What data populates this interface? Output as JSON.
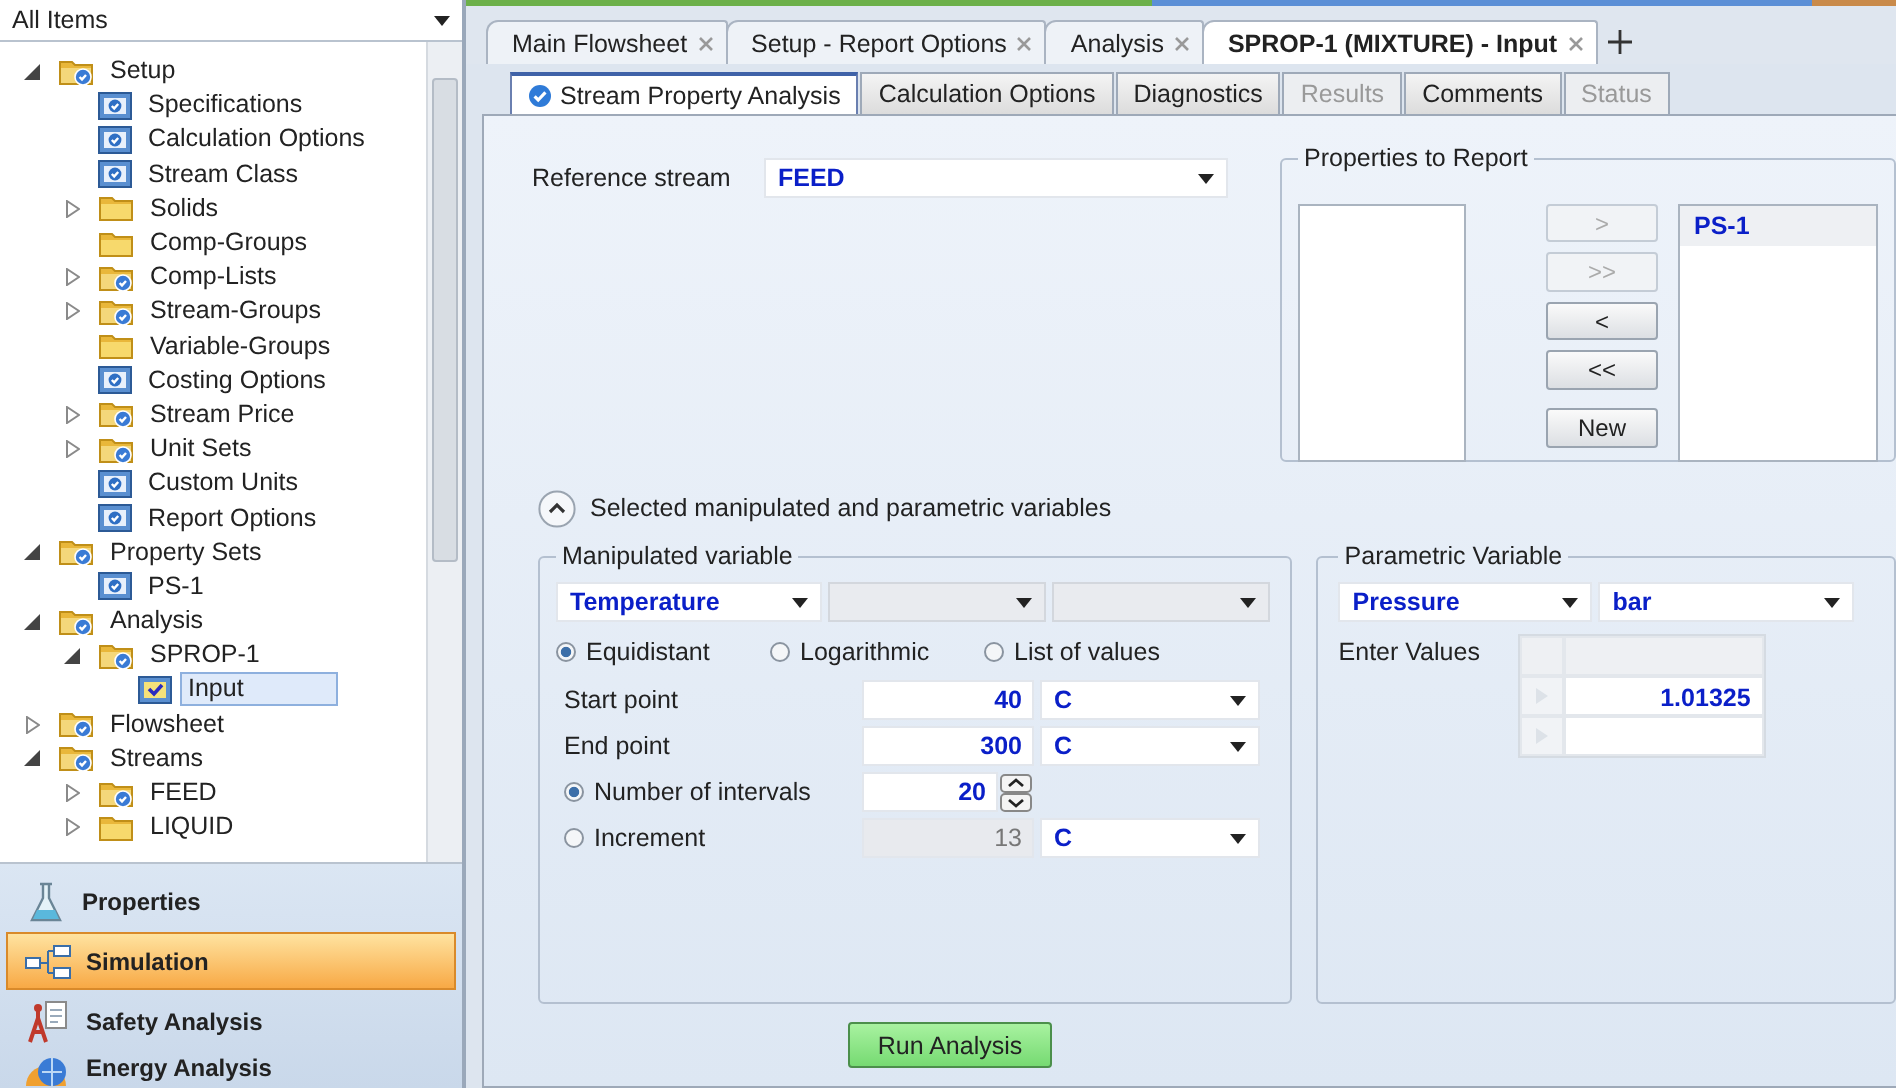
{
  "sidebar": {
    "filter": "All Items",
    "tree": [
      {
        "label": "Setup",
        "kind": "folder-check",
        "expanded": true,
        "selected": false,
        "children": [
          {
            "label": "Specifications",
            "kind": "form",
            "selected": false
          },
          {
            "label": "Calculation Options",
            "kind": "form",
            "selected": false
          },
          {
            "label": "Stream Class",
            "kind": "form",
            "selected": false
          },
          {
            "label": "Solids",
            "kind": "folder",
            "expanded": false,
            "selected": false
          },
          {
            "label": "Comp-Groups",
            "kind": "folder",
            "selected": false
          },
          {
            "label": "Comp-Lists",
            "kind": "folder-check",
            "expanded": false,
            "selected": false
          },
          {
            "label": "Stream-Groups",
            "kind": "folder-check",
            "expanded": false,
            "selected": false
          },
          {
            "label": "Variable-Groups",
            "kind": "folder",
            "selected": false
          },
          {
            "label": "Costing Options",
            "kind": "form",
            "selected": false
          },
          {
            "label": "Stream Price",
            "kind": "folder-check",
            "expanded": false,
            "selected": false
          },
          {
            "label": "Unit Sets",
            "kind": "folder-check",
            "expanded": false,
            "selected": false
          },
          {
            "label": "Custom Units",
            "kind": "form",
            "selected": false
          },
          {
            "label": "Report Options",
            "kind": "form",
            "selected": false
          }
        ]
      },
      {
        "label": "Property Sets",
        "kind": "folder-check",
        "expanded": true,
        "selected": false,
        "children": [
          {
            "label": "PS-1",
            "kind": "form",
            "selected": false
          }
        ]
      },
      {
        "label": "Analysis",
        "kind": "folder-check",
        "expanded": true,
        "selected": false,
        "children": [
          {
            "label": "SPROP-1",
            "kind": "folder-check",
            "expanded": true,
            "selected": false,
            "children": [
              {
                "label": "Input",
                "kind": "input",
                "selected": true
              }
            ]
          }
        ]
      },
      {
        "label": "Flowsheet",
        "kind": "folder-check",
        "expanded": false,
        "selected": false
      },
      {
        "label": "Streams",
        "kind": "folder-check",
        "expanded": true,
        "selected": false,
        "children": [
          {
            "label": "FEED",
            "kind": "folder-check",
            "expanded": false,
            "selected": false
          },
          {
            "label": "LIQUID",
            "kind": "folder",
            "expanded": false,
            "selected": false
          }
        ]
      }
    ],
    "nav": [
      {
        "label": "Properties",
        "kind": "flask",
        "selected": false
      },
      {
        "label": "Simulation",
        "kind": "flowchart",
        "selected": true
      },
      {
        "label": "Safety Analysis",
        "kind": "safety",
        "selected": false
      },
      {
        "label": "Energy Analysis",
        "kind": "globe",
        "selected": false
      }
    ]
  },
  "document_tabs": [
    {
      "label": "Main Flowsheet",
      "selected": false
    },
    {
      "label": "Setup - Report Options",
      "selected": false
    },
    {
      "label": "Analysis",
      "selected": false
    },
    {
      "label": "SPROP-1 (MIXTURE) - Input",
      "selected": true
    }
  ],
  "form_tabs": [
    {
      "label": "Stream Property Analysis",
      "selected": true,
      "disabled": false,
      "complete": true
    },
    {
      "label": "Calculation Options",
      "selected": false,
      "disabled": false,
      "complete": false
    },
    {
      "label": "Diagnostics",
      "selected": false,
      "disabled": false,
      "complete": false
    },
    {
      "label": "Results",
      "selected": false,
      "disabled": true,
      "complete": false
    },
    {
      "label": "Comments",
      "selected": false,
      "disabled": false,
      "complete": false
    },
    {
      "label": "Status",
      "selected": false,
      "disabled": true,
      "complete": false
    }
  ],
  "reference_stream": {
    "label": "Reference stream",
    "value": "FEED"
  },
  "properties_to_report": {
    "title": "Properties to Report",
    "buttons": [
      {
        "label": ">",
        "disabled": true
      },
      {
        "label": ">>",
        "disabled": true
      },
      {
        "label": "<",
        "disabled": false
      },
      {
        "label": "<<",
        "disabled": false
      },
      {
        "label": "New",
        "disabled": false
      }
    ],
    "selected_items": [
      {
        "label": "PS-1",
        "selected": true
      }
    ]
  },
  "variables_section": {
    "label": "Selected manipulated and parametric variables",
    "expanded": true
  },
  "manipulated": {
    "title": "Manipulated variable",
    "variable": "Temperature",
    "spacing": [
      {
        "label": "Equidistant",
        "selected": true
      },
      {
        "label": "Logarithmic",
        "selected": false
      },
      {
        "label": "List of values",
        "selected": false
      }
    ],
    "start": {
      "label": "Start point",
      "value": "40",
      "unit": "C"
    },
    "end": {
      "label": "End point",
      "value": "300",
      "unit": "C"
    },
    "intervals": {
      "label": "Number of intervals",
      "selected": true,
      "value": "20"
    },
    "increment": {
      "label": "Increment",
      "selected": false,
      "value": "13",
      "unit": "C"
    }
  },
  "parametric": {
    "title": "Parametric Variable",
    "variable": "Pressure",
    "unit": "bar",
    "values_label": "Enter Values",
    "values": [
      "1.01325"
    ]
  },
  "run_button": "Run Analysis"
}
